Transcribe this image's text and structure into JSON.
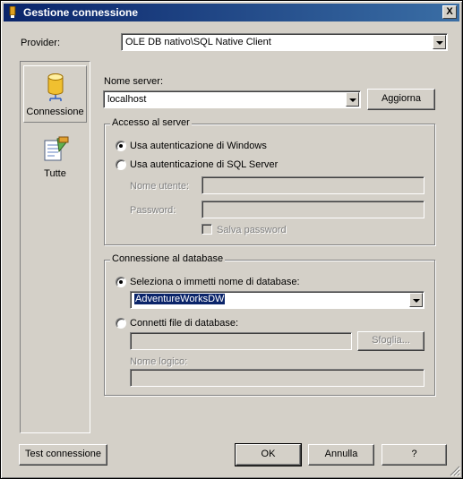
{
  "window": {
    "title": "Gestione connessione",
    "close_label": "X"
  },
  "provider": {
    "label": "Provider:",
    "value": "OLE DB nativo\\SQL Native Client"
  },
  "sidebar": {
    "items": [
      {
        "label": "Connessione",
        "icon": "database-icon",
        "selected": true
      },
      {
        "label": "Tutte",
        "icon": "properties-icon",
        "selected": false
      }
    ]
  },
  "server": {
    "label": "Nome server:",
    "value": "localhost",
    "refresh_label": "Aggiorna"
  },
  "access": {
    "legend": "Accesso al server",
    "windows_auth_label": "Usa autenticazione di Windows",
    "sql_auth_label": "Usa autenticazione di SQL Server",
    "username_label": "Nome utente:",
    "password_label": "Password:",
    "save_password_label": "Salva password",
    "selected": "windows"
  },
  "database": {
    "legend": "Connessione al database",
    "select_label": "Seleziona o immetti nome di database:",
    "db_value": "AdventureWorksDW",
    "attach_label": "Connetti file di database:",
    "browse_label": "Sfoglia...",
    "logical_name_label": "Nome logico:",
    "selected": "select"
  },
  "footer": {
    "test_label": "Test connessione",
    "ok_label": "OK",
    "cancel_label": "Annulla",
    "help_label": "?"
  }
}
